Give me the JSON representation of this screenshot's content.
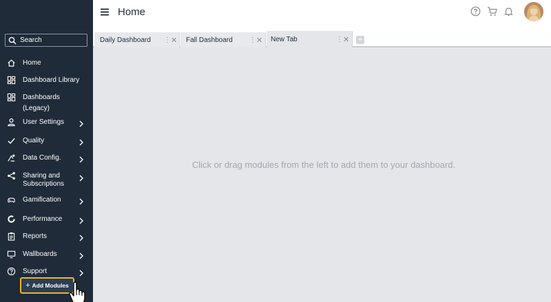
{
  "sidebar": {
    "search_placeholder": "Search",
    "items": [
      {
        "label": "Home",
        "icon": "home-icon",
        "chevron": false
      },
      {
        "label": "Dashboard Library",
        "icon": "grid-icon",
        "chevron": false
      },
      {
        "label": "Dashboards",
        "label2": "(Legacy)",
        "icon": "grid-icon",
        "chevron": false
      },
      {
        "label": "User Settings",
        "icon": "user-icon",
        "chevron": true
      },
      {
        "label": "Quality",
        "icon": "check-icon",
        "chevron": true
      },
      {
        "label": "Data Config.",
        "icon": "data-config-icon",
        "chevron": true
      },
      {
        "label": "Sharing and",
        "label2": "Subscriptions",
        "icon": "share-icon",
        "chevron": true
      },
      {
        "label": "Gamification",
        "icon": "gamepad-icon",
        "chevron": true
      },
      {
        "label": "Performance",
        "icon": "donut-icon",
        "chevron": true
      },
      {
        "label": "Reports",
        "icon": "clipboard-icon",
        "chevron": true
      },
      {
        "label": "Wallboards",
        "icon": "monitor-icon",
        "chevron": true
      },
      {
        "label": "Support",
        "icon": "help-icon",
        "chevron": true
      }
    ],
    "add_modules_label": "Add Modules"
  },
  "header": {
    "title": "Home"
  },
  "tabs": [
    {
      "label": "Daily Dashboard",
      "active": false
    },
    {
      "label": "Fall Dashboard",
      "active": false
    },
    {
      "label": "New Tab",
      "active": true
    }
  ],
  "main": {
    "empty_message": "Click or drag modules from the left to add them to your dashboard."
  },
  "colors": {
    "sidebar_bg": "#1f2b38",
    "highlight": "#f0b429",
    "canvas_bg": "#e4e6e9"
  }
}
